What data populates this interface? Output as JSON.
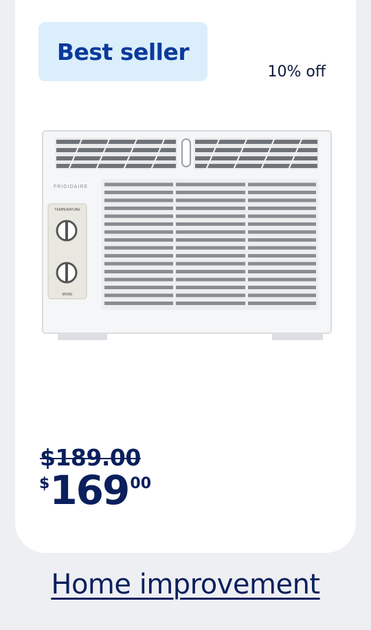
{
  "card": {
    "badge": "Best seller",
    "discount": "10% off",
    "product_brand": "FRIGIDAIRE",
    "knob_top_label": "TEMPERATURE",
    "knob_bottom_label": "MODE",
    "original_price": "$189.00",
    "price_currency": "$",
    "price_dollars": "169",
    "price_cents": "00"
  },
  "footer": {
    "link": "Home improvement"
  },
  "colors": {
    "badge_bg": "#dbeefb",
    "badge_text": "#0a3a9b",
    "price_text": "#0a1f5c",
    "page_bg": "#eeeff3"
  }
}
